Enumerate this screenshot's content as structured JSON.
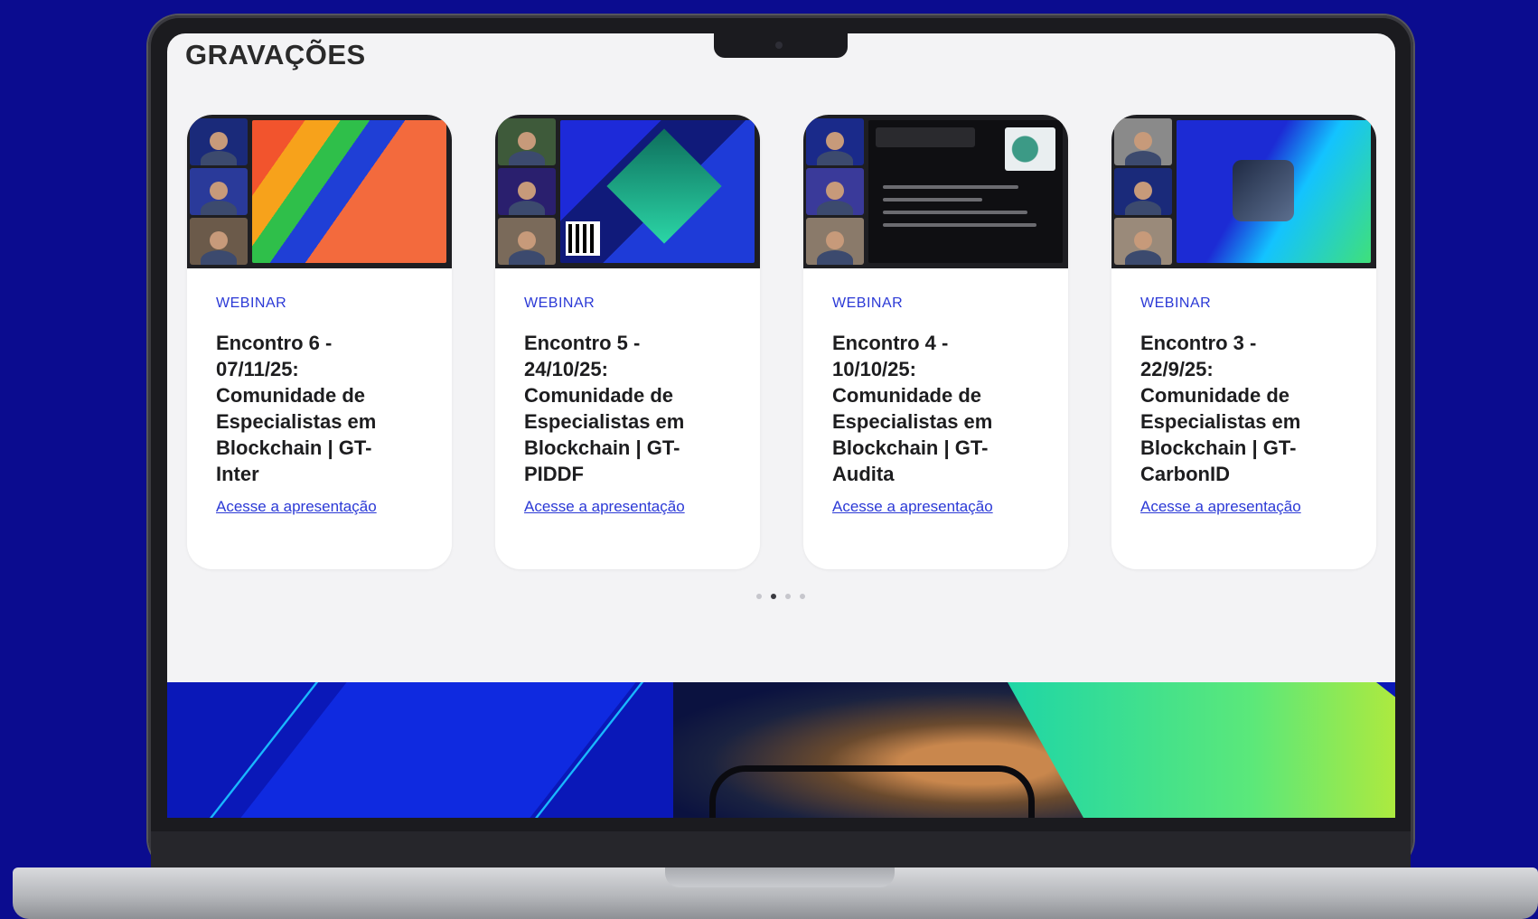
{
  "section_title": "GRAVAÇÕES",
  "cards": [
    {
      "tag": "WEBINAR",
      "title": "Encontro 6 - 07/11/25: Comunidade de Especialistas em Blockchain | GT-Inter",
      "link": "Acesse a apresentação"
    },
    {
      "tag": "WEBINAR",
      "title": "Encontro 5 - 24/10/25: Comunidade de Especialistas em Blockchain | GT-PIDDF",
      "link": "Acesse a apresentação"
    },
    {
      "tag": "WEBINAR",
      "title": "Encontro 4 - 10/10/25: Comunidade de Especialistas em Blockchain | GT-Audita",
      "link": "Acesse a apresentação"
    },
    {
      "tag": "WEBINAR",
      "title": "Encontro 3 - 22/9/25: Comunidade de Especialistas em Blockchain | GT-CarbonID",
      "link": "Acesse a apresentação"
    }
  ],
  "carousel": {
    "page_count": 4,
    "active_index": 1
  },
  "colors": {
    "background": "#0b0c8f",
    "accent": "#2b39d6",
    "screen": "#f3f3f5"
  }
}
